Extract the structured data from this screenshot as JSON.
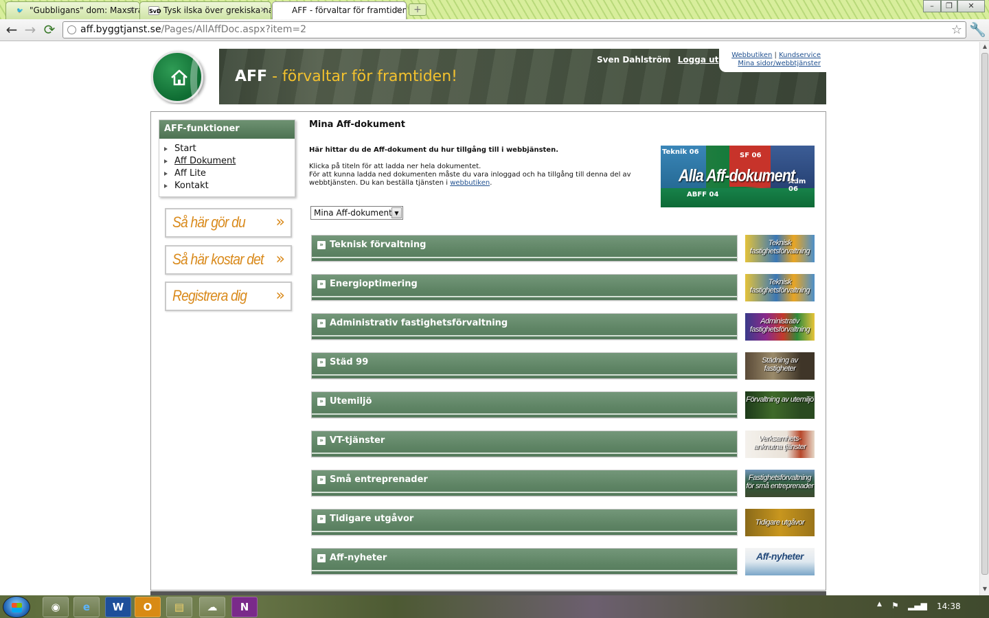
{
  "browser": {
    "tabs": [
      {
        "title": "\"Gubbligans\" dom: Maxstra",
        "favicon": "SVD-bird"
      },
      {
        "title": "Tysk ilska över grekiska nazi",
        "favicon": "SvD"
      },
      {
        "title": "AFF - förvaltar för framtiden",
        "favicon": ""
      }
    ],
    "url_host": "aff.byggtjanst.se",
    "url_path": "/Pages/AllAffDoc.aspx?item=2"
  },
  "header": {
    "brand": "AFF",
    "slogan": " - förvaltar för framtiden!",
    "user_name": "Sven Dahlström",
    "logout": "Logga ut",
    "link_shop": "Webbutiken",
    "link_sep": "|",
    "link_service": "Kundservice",
    "link_mypages": "Mina sidor/webbtjänster"
  },
  "sidebar": {
    "heading": "AFF-funktioner",
    "items": [
      {
        "label": "Start"
      },
      {
        "label": "Aff Dokument"
      },
      {
        "label": "Aff Lite"
      },
      {
        "label": "Kontakt"
      }
    ],
    "promos": [
      {
        "label": "Så här gör du"
      },
      {
        "label": "Så här kostar det"
      },
      {
        "label": "Registrera dig"
      }
    ]
  },
  "main": {
    "title": "Mina Aff-dokument",
    "intro_bold": "Här hittar du de Aff-dokument du hur tillgång till i webbjänsten.",
    "intro_line1": "Klicka på titeln för att ladda ner hela dokumentet.",
    "intro_line2": "För att kunna ladda ned dokumenten måste du vara inloggad och ha tillgång till denna del av webbtjänsten. Du kan beställa tjänsten i ",
    "intro_link": "webbutiken",
    "intro_end": ".",
    "banner": {
      "big": "Alla Aff-dokument",
      "label1": "Teknik 06",
      "label2": "SF 06",
      "label3": "ABFF 04",
      "label4": "Adm 06"
    },
    "select_value": "Mina Aff-dokument",
    "categories": [
      {
        "label": "Teknisk förvaltning",
        "thumb": "Teknisk fastighetsförvaltning"
      },
      {
        "label": "Energioptimering",
        "thumb": "Teknisk fastighetsförvaltning"
      },
      {
        "label": "Administrativ fastighetsförvaltning",
        "thumb": "Administrativ fastighetsförvaltning"
      },
      {
        "label": "Städ 99",
        "thumb": "Städning av fastigheter"
      },
      {
        "label": "Utemiljö",
        "thumb": "Förvaltning av utemiljö"
      },
      {
        "label": "VT-tjänster",
        "thumb": "Verksamhets-anknutna tjänster"
      },
      {
        "label": "Små entreprenader",
        "thumb": "Fastighetsförvaltning för små entreprenader"
      },
      {
        "label": "Tidigare utgåvor",
        "thumb": "Tidigare utgåvor"
      },
      {
        "label": "Aff-nyheter",
        "thumb": "Aff-nyheter"
      }
    ]
  },
  "taskbar": {
    "clock": "14:38"
  },
  "colors": {
    "green": "#5e8464",
    "orange": "#d98a1c",
    "title_yellow": "#f2c12e"
  }
}
